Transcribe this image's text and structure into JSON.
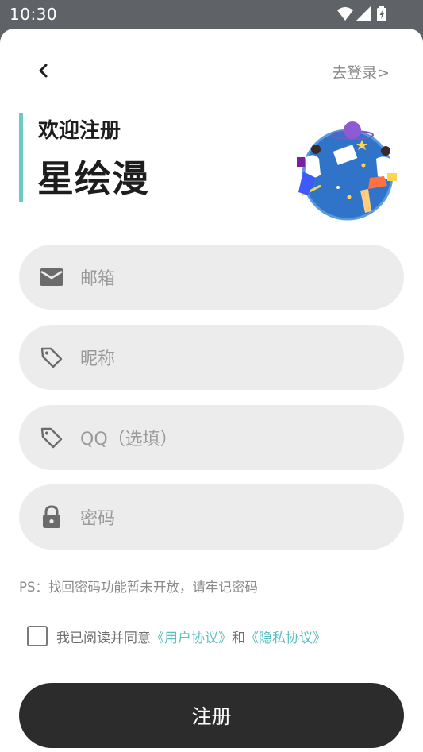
{
  "status_bar": {
    "time": "10:30"
  },
  "header": {
    "login_link": "去登录>"
  },
  "welcome": {
    "line1": "欢迎注册",
    "brand": "星绘漫"
  },
  "form": {
    "email_placeholder": "邮箱",
    "nickname_placeholder": "昵称",
    "qq_placeholder": "QQ（选填）",
    "password_placeholder": "密码"
  },
  "ps_note": "PS：找回密码功能暂未开放，请牢记密码",
  "agreement": {
    "prefix": "我已阅读并同意",
    "user_agreement": "《用户协议》",
    "conjunction": "和",
    "privacy_agreement": "《隐私协议》",
    "checked": false
  },
  "submit_label": "注册",
  "colors": {
    "accent": "#6cc9c5",
    "link": "#5cc0c2",
    "button_bg": "#2c2c2c",
    "field_bg": "#ececec"
  }
}
